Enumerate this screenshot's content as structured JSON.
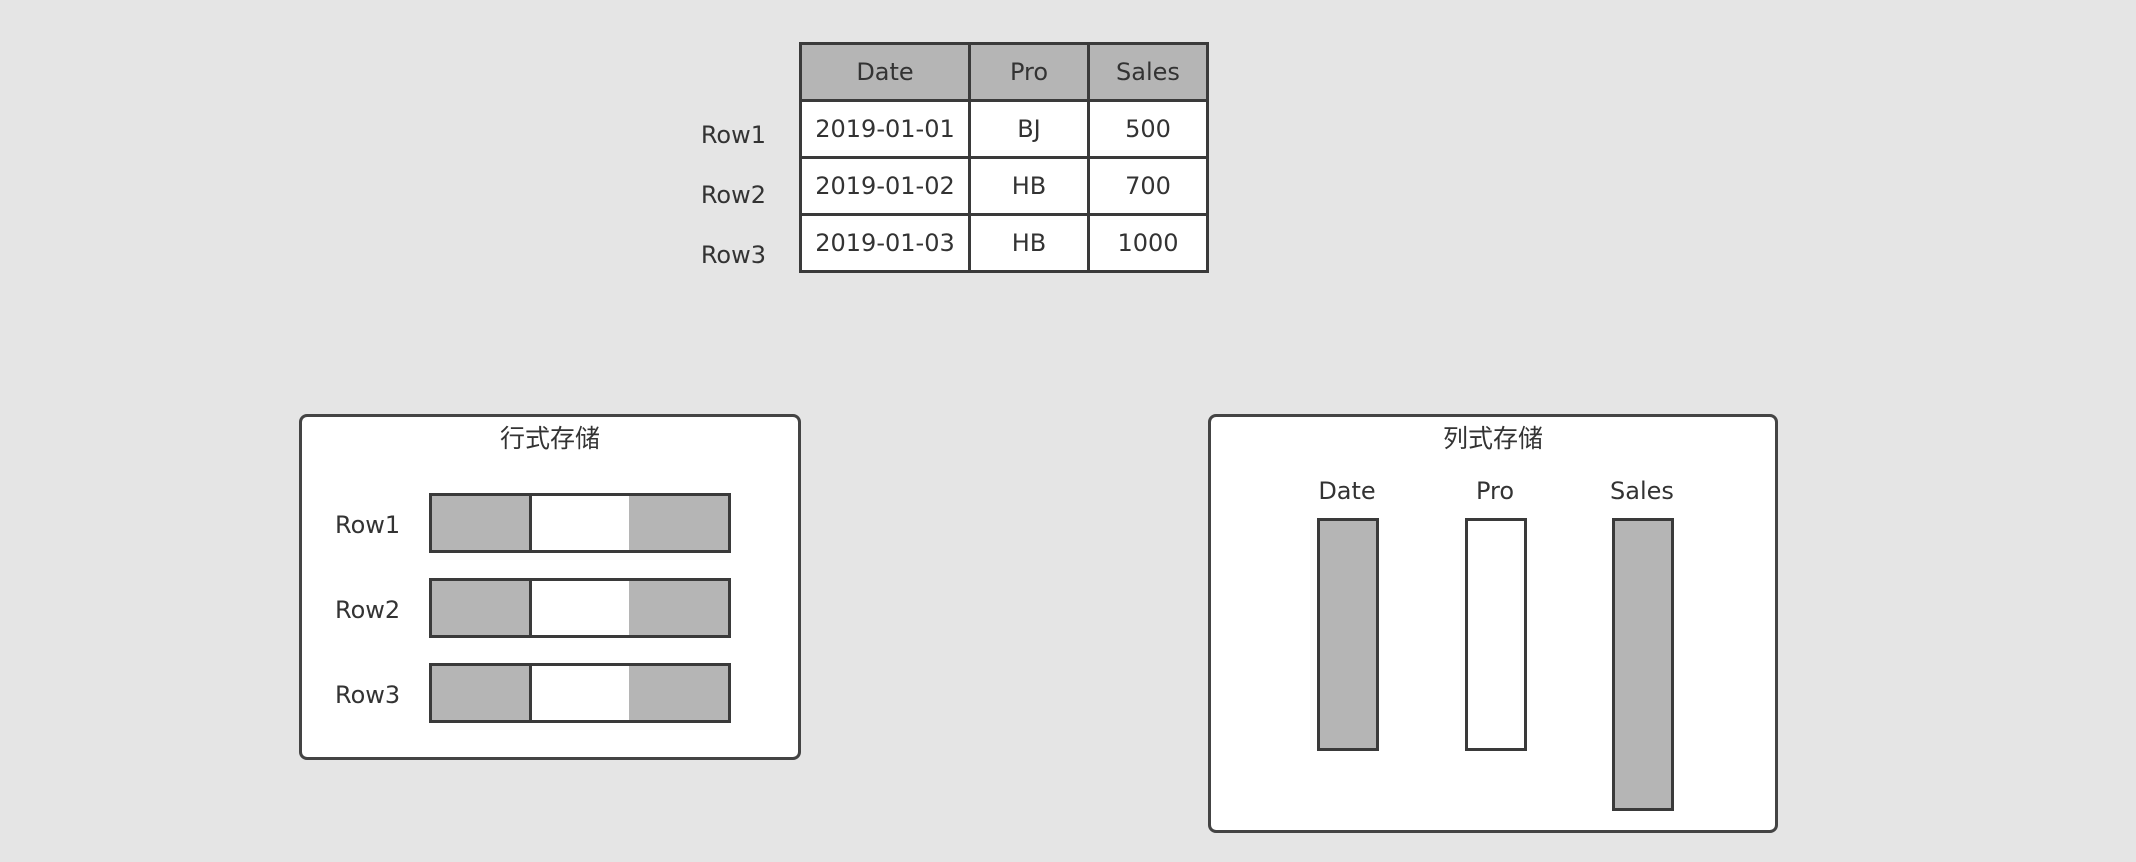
{
  "table": {
    "headers": [
      "Date",
      "Pro",
      "Sales"
    ],
    "rows": [
      {
        "label": "Row1",
        "cells": [
          "2019-01-01",
          "BJ",
          "500"
        ]
      },
      {
        "label": "Row2",
        "cells": [
          "2019-01-02",
          "HB",
          "700"
        ]
      },
      {
        "label": "Row3",
        "cells": [
          "2019-01-03",
          "HB",
          "1000"
        ]
      }
    ]
  },
  "row_store": {
    "title": "行式存储",
    "rows": [
      "Row1",
      "Row2",
      "Row3"
    ]
  },
  "column_store": {
    "title": "列式存储",
    "columns": [
      "Date",
      "Pro",
      "Sales"
    ]
  },
  "colors": {
    "background": "#e5e5e5",
    "header_fill": "#b5b5b5",
    "cell_fill": "#ffffff",
    "border": "#3a3a3a"
  }
}
